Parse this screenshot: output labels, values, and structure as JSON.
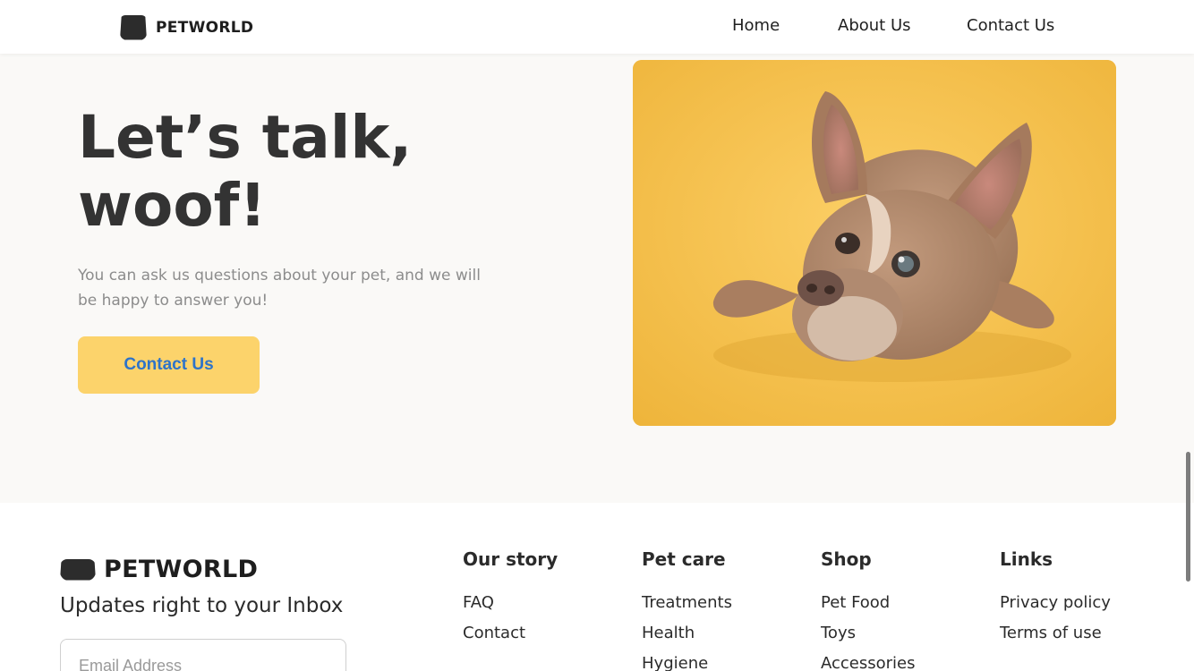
{
  "nav": {
    "brand": "PETWORLD",
    "links": [
      "Home",
      "About Us",
      "Contact Us"
    ]
  },
  "hero": {
    "title": "Let’s talk, woof!",
    "text": "You can ask us questions about your pet, and we will be happy to answer you!",
    "button": "Contact Us"
  },
  "footer": {
    "brand": "PETWORLD",
    "tagline": "Updates right to your Inbox",
    "email_placeholder": "Email Address",
    "columns": [
      {
        "title": "Our story",
        "items": [
          "FAQ",
          "Contact"
        ]
      },
      {
        "title": "Pet care",
        "items": [
          "Treatments",
          "Health",
          "Hygiene"
        ]
      },
      {
        "title": "Shop",
        "items": [
          "Pet Food",
          "Toys",
          "Accessories"
        ]
      },
      {
        "title": "Links",
        "items": [
          "Privacy policy",
          "Terms of use"
        ]
      }
    ]
  },
  "colors": {
    "accent": "#fcd36b",
    "button_text": "#2d73c9",
    "hero_background": "#faf9f7"
  }
}
